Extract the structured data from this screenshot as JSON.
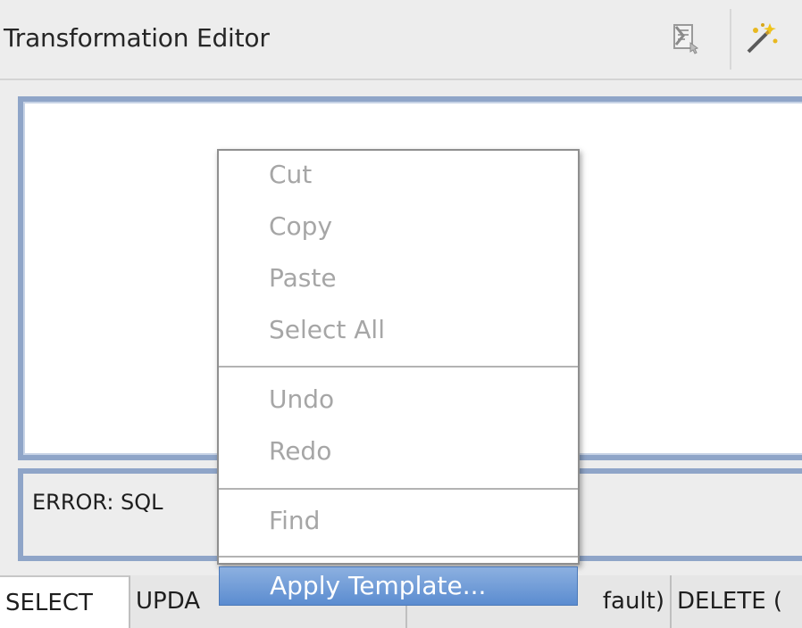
{
  "header": {
    "title": "Transformation Editor",
    "icons": [
      "query-builder-icon",
      "wand-icon"
    ]
  },
  "message": {
    "text": "ERROR: SQL"
  },
  "tabs": [
    {
      "label": "SELECT",
      "active": true
    },
    {
      "label": "UPDA",
      "active": false
    },
    {
      "label": "fault)",
      "active": false
    },
    {
      "label": "DELETE (",
      "active": false
    }
  ],
  "context_menu": {
    "items": [
      {
        "label": "Cut",
        "enabled": false
      },
      {
        "label": "Copy",
        "enabled": false
      },
      {
        "label": "Paste",
        "enabled": false
      },
      {
        "label": "Select All",
        "enabled": false
      },
      {
        "label": "Undo",
        "enabled": false
      },
      {
        "label": "Redo",
        "enabled": false
      },
      {
        "label": "Find",
        "enabled": false
      },
      {
        "label": "Apply Template...",
        "enabled": true,
        "highlighted": true
      }
    ]
  },
  "colors": {
    "frame_border": "#8fa5c8",
    "menu_highlight": "#5b8cd0",
    "disabled_text": "#a6a6a6"
  }
}
